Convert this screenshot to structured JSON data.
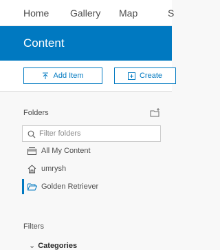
{
  "topnav": {
    "items": [
      "Home",
      "Gallery",
      "Map",
      "S"
    ]
  },
  "banner": {
    "title": "Content"
  },
  "actions": {
    "add_item": "Add Item",
    "create": "Create"
  },
  "folders": {
    "heading": "Folders",
    "filter_placeholder": "Filter folders",
    "items": [
      {
        "label": "All My Content",
        "icon": "drawer-icon"
      },
      {
        "label": "umrysh",
        "icon": "home-icon"
      },
      {
        "label": "Golden Retriever",
        "icon": "folder-open-icon",
        "active": true
      }
    ]
  },
  "filters": {
    "heading": "Filters",
    "categories_label": "Categories"
  },
  "colors": {
    "brand": "#0079c1",
    "text": "#4c4c4c"
  }
}
